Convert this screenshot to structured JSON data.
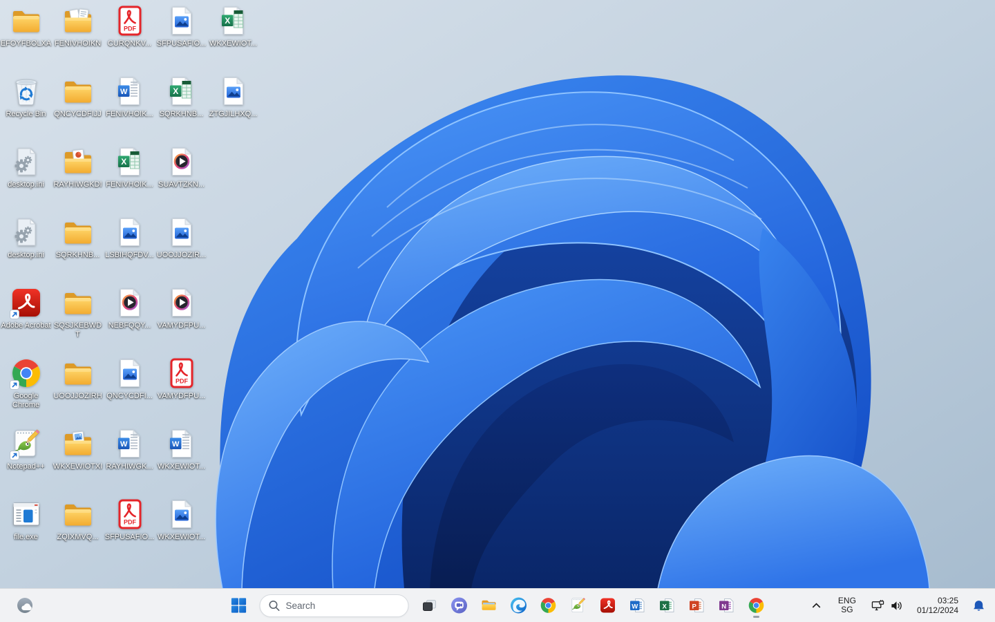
{
  "desktop": {
    "icons": [
      {
        "label": "EFOYFBOLXA",
        "type": "folder",
        "col": 1,
        "row": 1
      },
      {
        "label": "FENIVHOIKN",
        "type": "folder-docs",
        "col": 2,
        "row": 1
      },
      {
        "label": "CURQNKV...",
        "type": "pdf",
        "col": 3,
        "row": 1
      },
      {
        "label": "SFPUSAFIO...",
        "type": "image",
        "col": 4,
        "row": 1
      },
      {
        "label": "WKXEWIOT...",
        "type": "excel",
        "col": 5,
        "row": 1
      },
      {
        "label": "Recycle Bin",
        "type": "recycle-bin",
        "col": 1,
        "row": 2
      },
      {
        "label": "QNCYCDFIJJ",
        "type": "folder",
        "col": 2,
        "row": 2
      },
      {
        "label": "FENIVHOIK...",
        "type": "word",
        "col": 3,
        "row": 2
      },
      {
        "label": "SQRKHNB...",
        "type": "excel",
        "col": 4,
        "row": 2
      },
      {
        "label": "ZTGJILHXQ...",
        "type": "image",
        "col": 5,
        "row": 2
      },
      {
        "label": "desktop.ini",
        "type": "ini",
        "col": 1,
        "row": 3
      },
      {
        "label": "RAYHIWGKDI",
        "type": "folder-ppt",
        "col": 2,
        "row": 3
      },
      {
        "label": "FENIVHOIK...",
        "type": "excel",
        "col": 3,
        "row": 3
      },
      {
        "label": "SUAVTZKN...",
        "type": "media",
        "col": 4,
        "row": 3
      },
      {
        "label": "desktop.ini",
        "type": "ini",
        "col": 1,
        "row": 4
      },
      {
        "label": "SQRKHNB...",
        "type": "folder",
        "col": 2,
        "row": 4
      },
      {
        "label": "LSBIHQFDV...",
        "type": "image",
        "col": 3,
        "row": 4
      },
      {
        "label": "UOOJJOZIR...",
        "type": "image",
        "col": 4,
        "row": 4
      },
      {
        "label": "Adobe Acrobat",
        "type": "acrobat-app",
        "shortcut": true,
        "col": 1,
        "row": 5
      },
      {
        "label": "SQSJKEBWDT",
        "type": "folder",
        "col": 2,
        "row": 5
      },
      {
        "label": "NEBFQQY...",
        "type": "media",
        "col": 3,
        "row": 5
      },
      {
        "label": "VAMYDFPU...",
        "type": "media",
        "col": 4,
        "row": 5
      },
      {
        "label": "Google Chrome",
        "type": "chrome-app",
        "shortcut": true,
        "col": 1,
        "row": 6
      },
      {
        "label": "UOOJJOZIRH",
        "type": "folder",
        "col": 2,
        "row": 6
      },
      {
        "label": "QNCYCDFI...",
        "type": "image",
        "col": 3,
        "row": 6
      },
      {
        "label": "VAMYDFPU...",
        "type": "pdf",
        "col": 4,
        "row": 6
      },
      {
        "label": "Notepad++",
        "type": "npp-app",
        "shortcut": true,
        "col": 1,
        "row": 7
      },
      {
        "label": "WKXEWIOTXI",
        "type": "folder-image",
        "col": 2,
        "row": 7
      },
      {
        "label": "RAYHIWGK...",
        "type": "word",
        "col": 3,
        "row": 7
      },
      {
        "label": "WKXEWIOT...",
        "type": "word",
        "col": 4,
        "row": 7
      },
      {
        "label": "file.exe",
        "type": "exe-app",
        "col": 1,
        "row": 8
      },
      {
        "label": "ZQIXMVQ...",
        "type": "folder",
        "col": 2,
        "row": 8
      },
      {
        "label": "SFPUSAFIO...",
        "type": "pdf",
        "col": 3,
        "row": 8
      },
      {
        "label": "WKXEWIOT...",
        "type": "image",
        "col": 4,
        "row": 8
      }
    ]
  },
  "taskbar": {
    "widgets_icon": "widgets-weather-icon",
    "start_icon": "windows-start-icon",
    "search": {
      "placeholder": "Search"
    },
    "apps": [
      {
        "id": "task-view",
        "icon": "task-view"
      },
      {
        "id": "chat",
        "icon": "chat"
      },
      {
        "id": "file-explorer",
        "icon": "file-explorer"
      },
      {
        "id": "edge",
        "icon": "edge"
      },
      {
        "id": "chrome",
        "icon": "chrome"
      },
      {
        "id": "notepad-plus-plus",
        "icon": "npp"
      },
      {
        "id": "acrobat",
        "icon": "acrobat"
      },
      {
        "id": "word",
        "icon": "word"
      },
      {
        "id": "excel",
        "icon": "excel"
      },
      {
        "id": "powerpoint",
        "icon": "powerpoint"
      },
      {
        "id": "onenote",
        "icon": "onenote"
      },
      {
        "id": "chrome-running",
        "icon": "chrome",
        "running": true
      }
    ]
  },
  "tray": {
    "chevron_icon": "chevron-up-icon",
    "language": {
      "line1": "ENG",
      "line2": "SG"
    },
    "network_icon": "network-ethernet-icon",
    "volume_icon": "speaker-icon",
    "clock": {
      "time": "03:25",
      "date": "01/12/2024"
    },
    "notifications_icon": "bell-icon"
  },
  "colors": {
    "taskbar_bg": "#f1f2f4",
    "start_blue": "#0e6ed4",
    "bell_blue": "#1c57b8",
    "wallpaper_blue": "#1553cc",
    "wallpaper_bg": "#c2d1df"
  }
}
